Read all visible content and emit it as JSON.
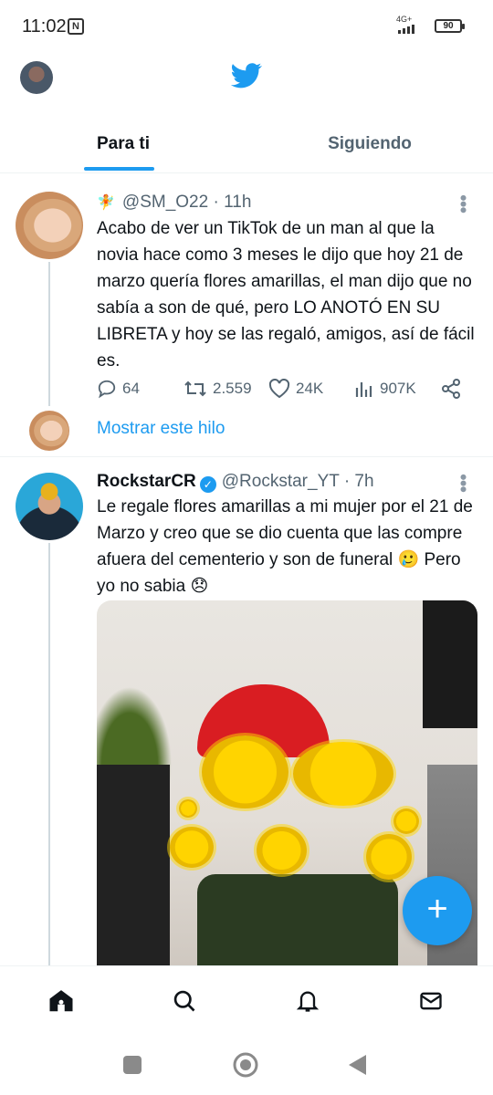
{
  "status_bar": {
    "time": "11:02",
    "nfc": "N",
    "network": "4G+",
    "battery": "90"
  },
  "header": {
    "avatar_icon": "profile-avatar",
    "logo_icon": "twitter-bird-icon",
    "brand_color": "#1d9bf0"
  },
  "tabs": [
    {
      "label": "Para ti",
      "active": true
    },
    {
      "label": "Siguiendo",
      "active": false
    }
  ],
  "tweets": [
    {
      "emoji": "🧚",
      "name": "",
      "handle": "@SM_O22",
      "time": "· 11h",
      "text": "Acabo de ver un TikTok de un man al que la novia hace como 3 meses le dijo que hoy 21 de marzo quería flores amarillas, el man dijo que no sabía a son de qué, pero LO ANOTÓ EN SU LIBRETA y hoy se las regaló, amigos, así de fácil es.",
      "replies": "64",
      "retweets": "2.559",
      "likes": "24K",
      "views": "907K",
      "show_thread": "Mostrar este hilo"
    },
    {
      "name": "RockstarCR",
      "verified": true,
      "handle": "@Rockstar_YT",
      "time": "· 7h",
      "text": "Le regale flores amarillas a mi mujer por el 21 de Marzo y creo que se dio cuenta que las compre afuera del cementerio y son de funeral 🥲 Pero yo no sabia 😞"
    }
  ],
  "fab": {
    "label": "+"
  },
  "bottom_nav": [
    "home-icon",
    "search-icon",
    "notifications-icon",
    "messages-icon"
  ],
  "system_nav": [
    "recents-button",
    "home-button",
    "back-button"
  ]
}
